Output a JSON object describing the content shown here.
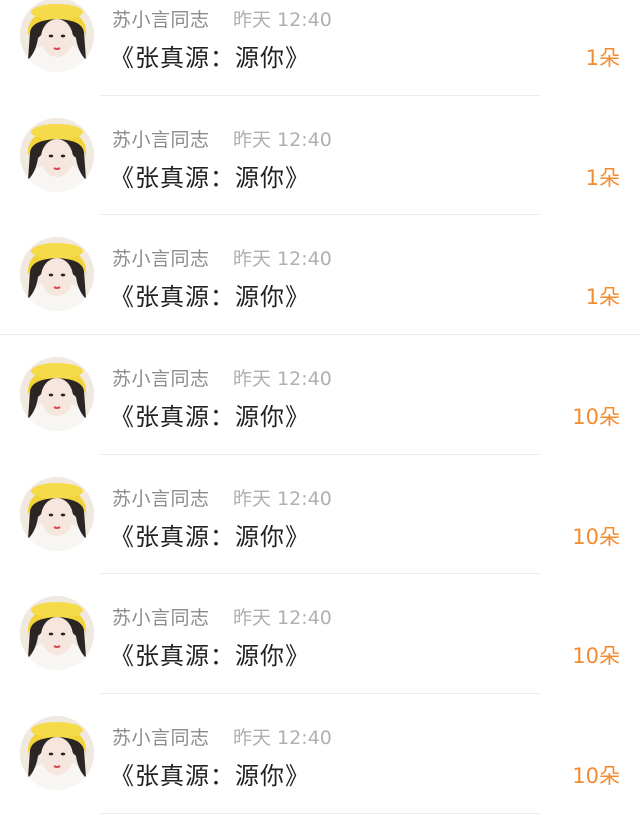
{
  "messages": [
    {
      "user": "苏小言同志",
      "time": "昨天 12:40",
      "content": "《张真源：源你》",
      "count": "1朵"
    },
    {
      "user": "苏小言同志",
      "time": "昨天 12:40",
      "content": "《张真源：源你》",
      "count": "1朵"
    },
    {
      "user": "苏小言同志",
      "time": "昨天 12:40",
      "content": "《张真源：源你》",
      "count": "1朵"
    },
    {
      "user": "苏小言同志",
      "time": "昨天 12:40",
      "content": "《张真源：源你》",
      "count": "10朵"
    },
    {
      "user": "苏小言同志",
      "time": "昨天 12:40",
      "content": "《张真源：源你》",
      "count": "10朵"
    },
    {
      "user": "苏小言同志",
      "time": "昨天 12:40",
      "content": "《张真源：源你》",
      "count": "10朵"
    },
    {
      "user": "苏小言同志",
      "time": "昨天 12:40",
      "content": "《张真源：源你》",
      "count": "10朵"
    }
  ],
  "colors": {
    "count": "#f58a2e",
    "username": "#8c8c8c",
    "timestamp": "#b0b0b0",
    "content": "#222222"
  },
  "icons": {
    "avatar": "user-avatar-photo"
  }
}
